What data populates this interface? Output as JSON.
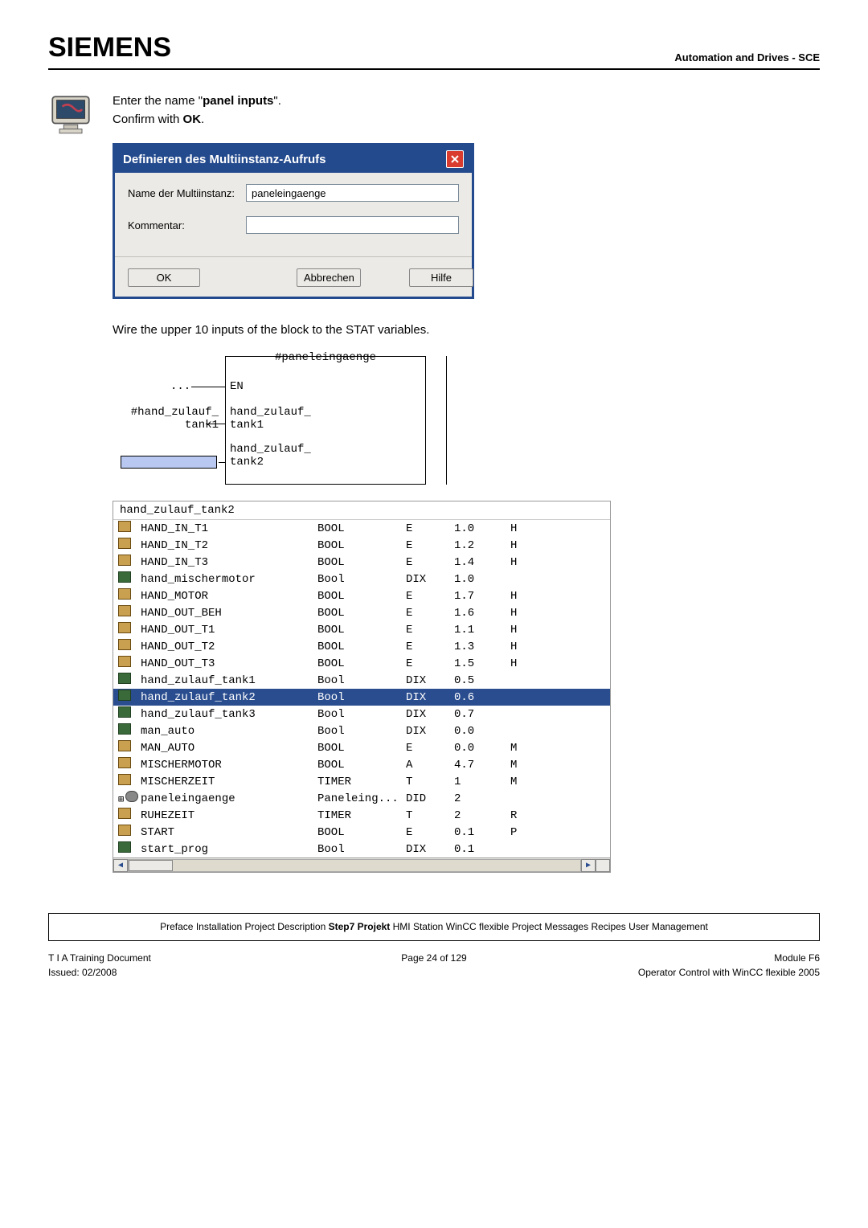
{
  "header": {
    "logo": "SIEMENS",
    "right": "Automation and Drives - SCE"
  },
  "instr1_a": "Enter the name \"",
  "instr1_b": "panel inputs",
  "instr1_c": "\".",
  "instr2_a": "Confirm with ",
  "instr2_b": "OK",
  "instr2_c": ".",
  "dialog": {
    "title": "Definieren des Multiinstanz-Aufrufs",
    "label_name": "Name der Multiinstanz:",
    "value_name": "paneleingaenge",
    "label_comment": "Kommentar:",
    "value_comment": "",
    "ok": "OK",
    "cancel": "Abbrechen",
    "help": "Hilfe"
  },
  "instr3": "Wire the upper 10 inputs of the block to the STAT variables.",
  "fbd": {
    "title": "#paneleingaenge",
    "en": "EN",
    "dots": "...",
    "in1_ext": "#hand_zulauf_\ntank1",
    "in1_int": "hand_zulauf_\ntank1",
    "in2_int": "hand_zulauf_\ntank2"
  },
  "var_header": "hand_zulauf_tank2",
  "vars": [
    {
      "icon": "global",
      "name": "HAND_IN_T1",
      "type": "BOOL",
      "cls": "E",
      "addr": "1.0",
      "c": "H"
    },
    {
      "icon": "global",
      "name": "HAND_IN_T2",
      "type": "BOOL",
      "cls": "E",
      "addr": "1.2",
      "c": "H"
    },
    {
      "icon": "global",
      "name": "HAND_IN_T3",
      "type": "BOOL",
      "cls": "E",
      "addr": "1.4",
      "c": "H"
    },
    {
      "icon": "local",
      "name": "hand_mischermotor",
      "type": "Bool",
      "cls": "DIX",
      "addr": "1.0",
      "c": ""
    },
    {
      "icon": "global",
      "name": "HAND_MOTOR",
      "type": "BOOL",
      "cls": "E",
      "addr": "1.7",
      "c": "H"
    },
    {
      "icon": "global",
      "name": "HAND_OUT_BEH",
      "type": "BOOL",
      "cls": "E",
      "addr": "1.6",
      "c": "H"
    },
    {
      "icon": "global",
      "name": "HAND_OUT_T1",
      "type": "BOOL",
      "cls": "E",
      "addr": "1.1",
      "c": "H"
    },
    {
      "icon": "global",
      "name": "HAND_OUT_T2",
      "type": "BOOL",
      "cls": "E",
      "addr": "1.3",
      "c": "H"
    },
    {
      "icon": "global",
      "name": "HAND_OUT_T3",
      "type": "BOOL",
      "cls": "E",
      "addr": "1.5",
      "c": "H"
    },
    {
      "icon": "local",
      "name": "hand_zulauf_tank1",
      "type": "Bool",
      "cls": "DIX",
      "addr": "0.5",
      "c": ""
    },
    {
      "icon": "local",
      "name": "hand_zulauf_tank2",
      "type": "Bool",
      "cls": "DIX",
      "addr": "0.6",
      "c": "",
      "sel": true
    },
    {
      "icon": "local",
      "name": "hand_zulauf_tank3",
      "type": "Bool",
      "cls": "DIX",
      "addr": "0.7",
      "c": ""
    },
    {
      "icon": "local",
      "name": "man_auto",
      "type": "Bool",
      "cls": "DIX",
      "addr": "0.0",
      "c": ""
    },
    {
      "icon": "global",
      "name": "MAN_AUTO",
      "type": "BOOL",
      "cls": "E",
      "addr": "0.0",
      "c": "M"
    },
    {
      "icon": "global",
      "name": "MISCHERMOTOR",
      "type": "BOOL",
      "cls": "A",
      "addr": "4.7",
      "c": "M"
    },
    {
      "icon": "global",
      "name": "MISCHERZEIT",
      "type": "TIMER",
      "cls": "T",
      "addr": "1",
      "c": "M"
    },
    {
      "icon": "struct",
      "name": "paneleingaenge",
      "type": "Paneleing...",
      "cls": "DID",
      "addr": "2",
      "c": "",
      "expand": "+"
    },
    {
      "icon": "global",
      "name": "RUHEZEIT",
      "type": "TIMER",
      "cls": "T",
      "addr": "2",
      "c": "R"
    },
    {
      "icon": "global",
      "name": "START",
      "type": "BOOL",
      "cls": "E",
      "addr": "0.1",
      "c": "P"
    },
    {
      "icon": "local",
      "name": "start_prog",
      "type": "Bool",
      "cls": "DIX",
      "addr": "0.1",
      "c": ""
    }
  ],
  "nav": {
    "items": [
      "Preface",
      "Installation",
      "Project Description",
      "Step7 Projekt",
      "HMI Station",
      "WinCC flexible Project",
      "Messages",
      "Recipes",
      "User Management"
    ],
    "active_index": 3
  },
  "footer": {
    "left1": "T I A  Training Document",
    "center1": "Page 24 of 129",
    "right1": "Module F6",
    "left2": "Issued: 02/2008",
    "right2": "Operator Control with WinCC flexible 2005"
  }
}
